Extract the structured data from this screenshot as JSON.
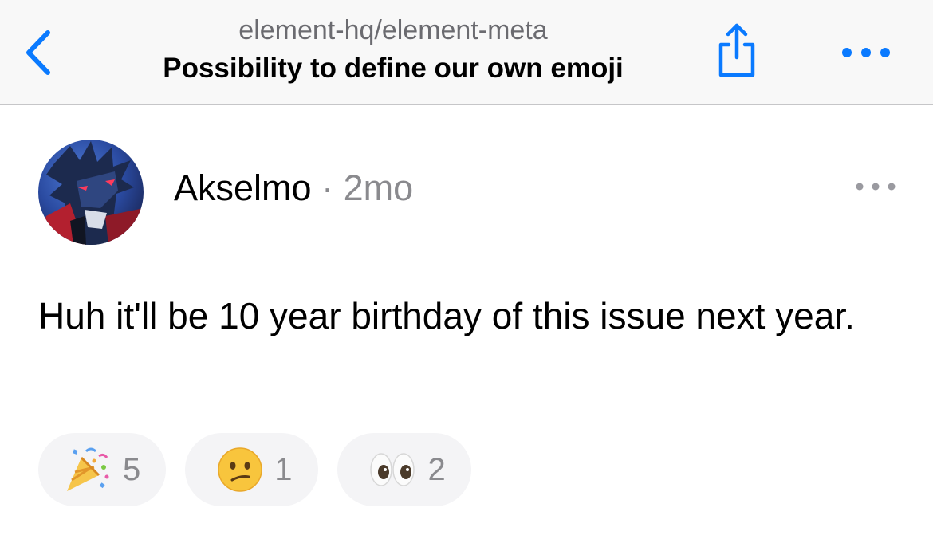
{
  "navbar": {
    "repo": "element-hq/element-meta",
    "title": "Possibility to define our own emoji",
    "back_icon": "chevron-left-icon",
    "share_icon": "share-icon",
    "more_icon": "ellipsis-icon",
    "accent_color": "#0a7aff"
  },
  "comment": {
    "author": "Akselmo",
    "separator": "·",
    "age": "2mo",
    "body": "Huh it'll be 10 year birthday of this issue next year.",
    "more_icon": "ellipsis-icon"
  },
  "reactions": [
    {
      "emoji": "party-popper-icon",
      "count": "5"
    },
    {
      "emoji": "confused-face-icon",
      "count": "1"
    },
    {
      "emoji": "eyes-icon",
      "count": "2"
    }
  ]
}
